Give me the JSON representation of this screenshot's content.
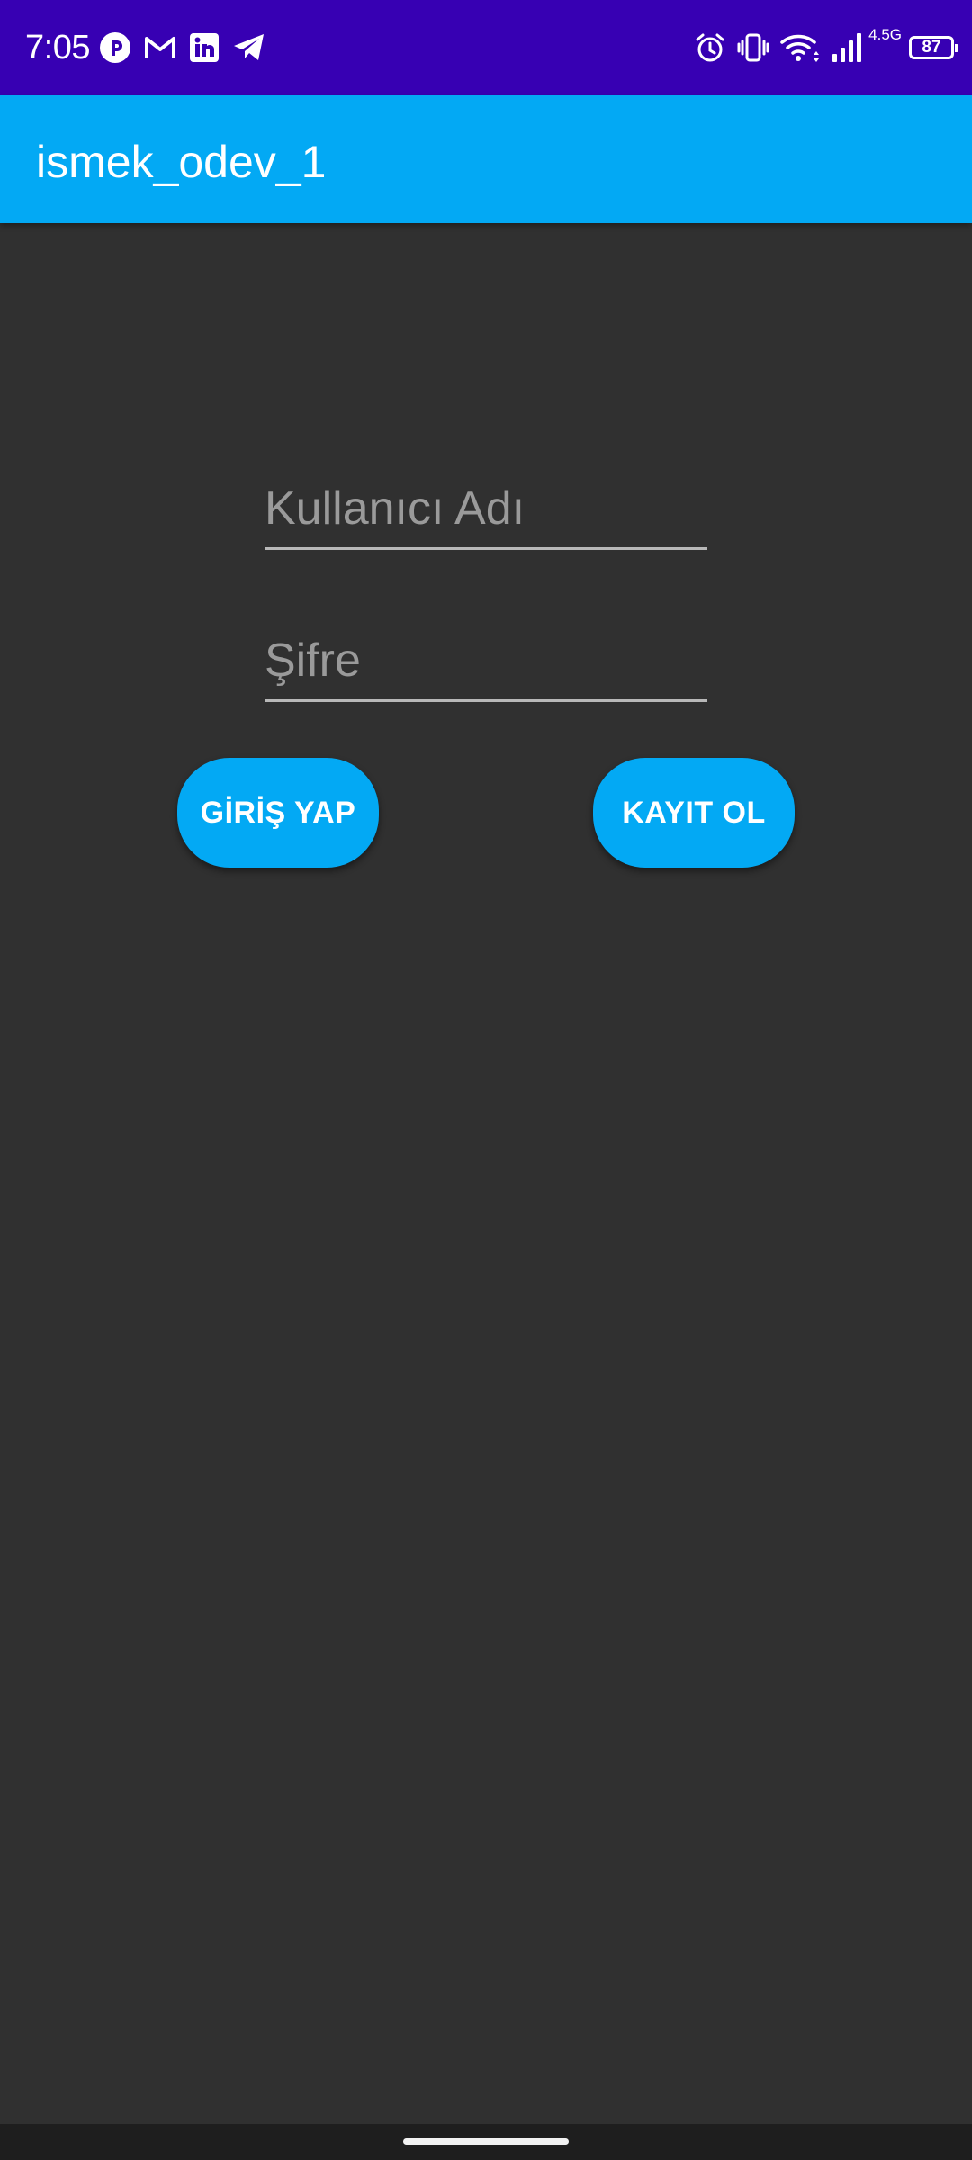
{
  "status_bar": {
    "time": "7:05",
    "network_type": "4.5G",
    "battery_level": "87",
    "background_color": "#3700b3",
    "notification_icons": [
      "pinterest-like-p-icon",
      "gmail-icon",
      "linkedin-icon",
      "telegram-icon"
    ],
    "system_icons": [
      "alarm-icon",
      "vibrate-icon",
      "wifi-icon",
      "signal-icon",
      "battery-icon"
    ]
  },
  "app_bar": {
    "title": "ismek_odev_1",
    "background_color": "#03a9f4"
  },
  "form": {
    "username": {
      "placeholder": "Kullanıcı Adı",
      "value": ""
    },
    "password": {
      "placeholder": "Şifre",
      "value": ""
    }
  },
  "buttons": {
    "login_label": "GİRİŞ YAP",
    "register_label": "KAYIT OL",
    "color": "#03a9f4"
  },
  "theme": {
    "background_color": "#303030"
  }
}
